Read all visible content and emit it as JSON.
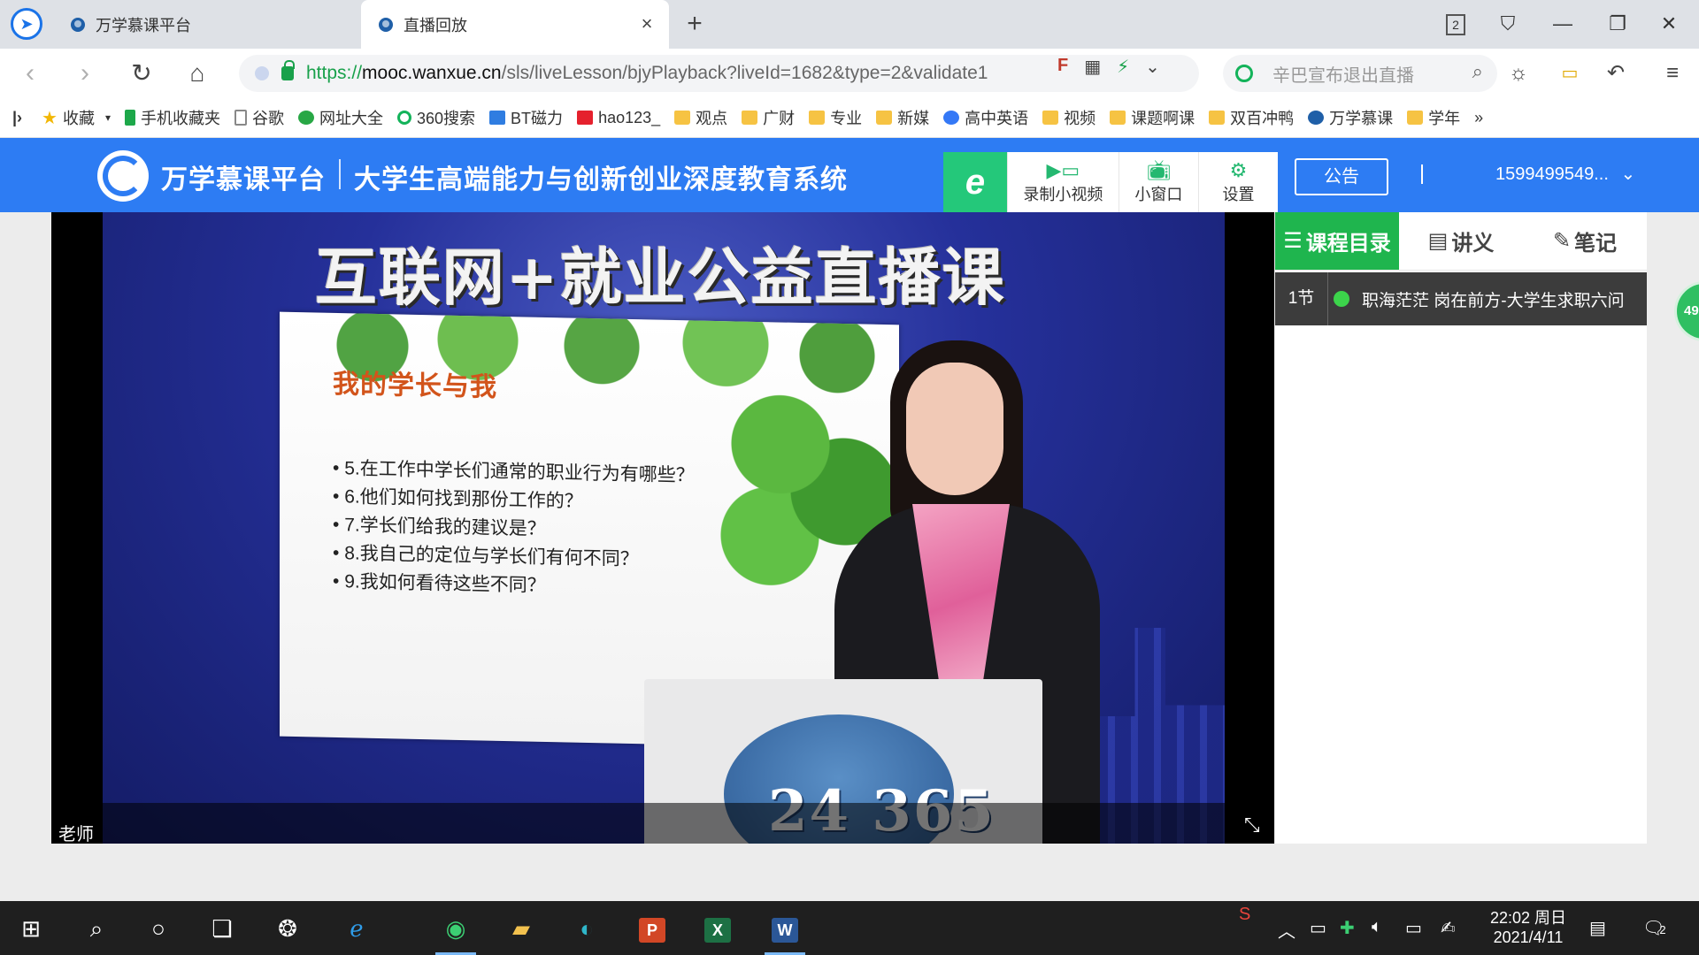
{
  "browser": {
    "tabs": [
      {
        "label": "万学慕课平台",
        "active": false
      },
      {
        "label": "直播回放",
        "active": true
      }
    ],
    "new_tab_icon": "plus-icon",
    "tab_count": "2",
    "address": {
      "scheme": "https://",
      "host": "mooc.wanxue.cn",
      "path": "/sls/liveLesson/bjyPlayback?liveId=1682&type=2&validate1"
    },
    "search_placeholder": "辛巴宣布退出直播",
    "bookmarks": [
      {
        "label": "收藏",
        "icon": "star-icon"
      },
      {
        "label": "手机收藏夹",
        "icon": "phone-icon"
      },
      {
        "label": "谷歌",
        "icon": "doc-icon"
      },
      {
        "label": "网址大全",
        "icon": "nav-icon"
      },
      {
        "label": "360搜索",
        "icon": "search360-icon"
      },
      {
        "label": "BT磁力",
        "icon": "bt-icon"
      },
      {
        "label": "hao123_",
        "icon": "hao123-icon"
      },
      {
        "label": "观点",
        "icon": "folder-icon"
      },
      {
        "label": "广财",
        "icon": "folder-icon"
      },
      {
        "label": "专业",
        "icon": "folder-icon"
      },
      {
        "label": "新媒",
        "icon": "folder-icon"
      },
      {
        "label": "高中英语",
        "icon": "baidu-icon"
      },
      {
        "label": "视频",
        "icon": "folder-icon"
      },
      {
        "label": "课题啊课",
        "icon": "folder-icon"
      },
      {
        "label": "双百冲鸭",
        "icon": "folder-icon"
      },
      {
        "label": "万学慕课",
        "icon": "site-icon"
      },
      {
        "label": "学年",
        "icon": "folder-icon"
      }
    ],
    "more_bookmarks": "»"
  },
  "site": {
    "name": "万学慕课平台",
    "slogan": "大学生高端能力与创新创业深度教育系统",
    "toolbar": {
      "record_label": "录制小视频",
      "mini_window_label": "小窗口",
      "settings_label": "设置"
    },
    "notice_label": "公告",
    "account": "1599499549..."
  },
  "video": {
    "stage_title": "互联网+就业公益直播课",
    "slide_heading": "我的学长与我",
    "slide_items": [
      "5.在工作中学长们通常的职业行为有哪些？",
      "6.他们如何找到那份工作的？",
      "7.学长们给我的建议是？",
      "8.我自己的定位与学长们有何不同？",
      "9.我如何看待这些不同？"
    ],
    "podium_text": "24 365",
    "speaker_label": "老师"
  },
  "panel": {
    "tabs": [
      {
        "label": "课程目录",
        "icon": "list-icon",
        "active": true
      },
      {
        "label": "讲义",
        "icon": "document-icon",
        "active": false
      },
      {
        "label": "笔记",
        "icon": "edit-icon",
        "active": false
      }
    ],
    "lesson": {
      "index": "1节",
      "title": "职海茫茫 岗在前方-大学生求职六问"
    },
    "float_badge": "49"
  },
  "taskbar": {
    "time": "22:02 周日",
    "date": "2021/4/11",
    "notification_count": "2"
  },
  "colors": {
    "header_blue": "#2d7cf3",
    "accent_green": "#1fb54e",
    "url_green": "#19a14b"
  }
}
